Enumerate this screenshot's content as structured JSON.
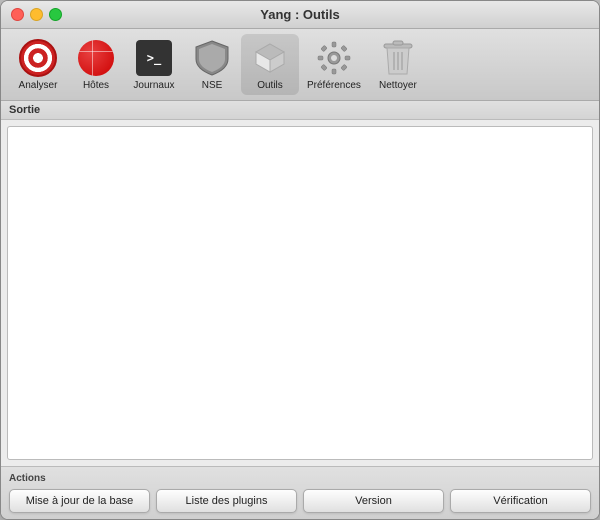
{
  "window": {
    "title": "Yang : Outils"
  },
  "titlebar": {
    "title": "Yang : Outils"
  },
  "toolbar": {
    "items": [
      {
        "id": "analyser",
        "label": "Analyser",
        "icon": "target-icon"
      },
      {
        "id": "hotes",
        "label": "Hôtes",
        "icon": "globe-icon"
      },
      {
        "id": "journaux",
        "label": "Journaux",
        "icon": "terminal-icon"
      },
      {
        "id": "nse",
        "label": "NSE",
        "icon": "shield-icon"
      },
      {
        "id": "outils",
        "label": "Outils",
        "icon": "box-icon"
      },
      {
        "id": "preferences",
        "label": "Préférences",
        "icon": "gear-icon"
      },
      {
        "id": "nettoyer",
        "label": "Nettoyer",
        "icon": "trash-icon"
      }
    ]
  },
  "section": {
    "output_label": "Sortie",
    "actions_label": "Actions"
  },
  "buttons": {
    "mise_a_jour": "Mise à jour de la base",
    "liste_plugins": "Liste des plugins",
    "version": "Version",
    "verification": "Vérification"
  }
}
